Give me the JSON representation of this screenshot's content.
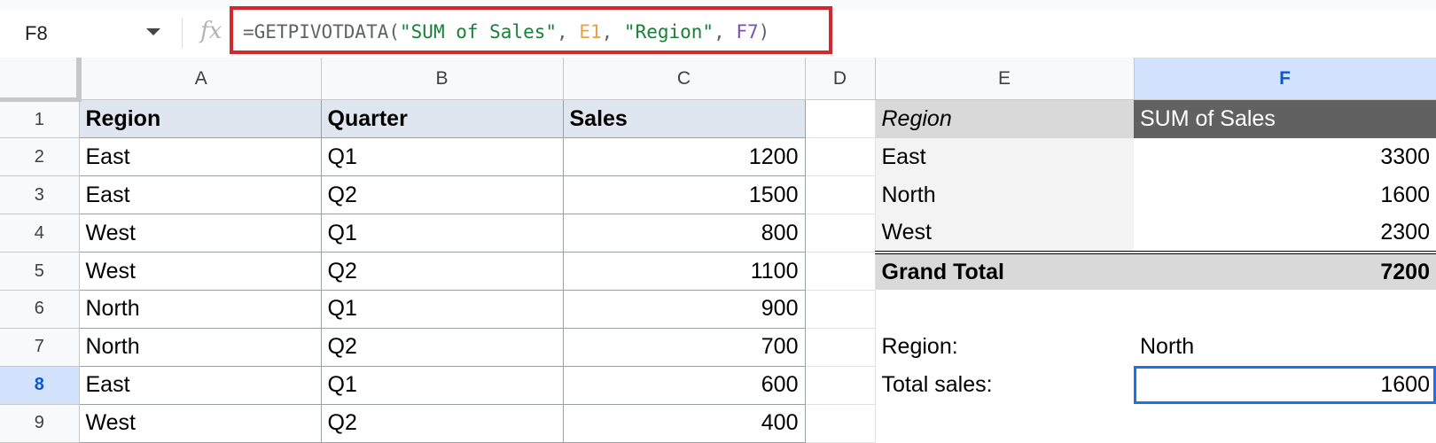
{
  "name_box": {
    "ref": "F8"
  },
  "formula_bar": {
    "fx_symbol": "fx",
    "formula_parts": {
      "start": "=GETPIVOTDATA(",
      "arg1": "\"SUM of Sales\"",
      "sep1": ", ",
      "arg2": "E1",
      "sep2": ", ",
      "arg3": "\"Region\"",
      "sep3": ", ",
      "arg4": "F7",
      "end": ")"
    }
  },
  "columns": [
    "A",
    "B",
    "C",
    "D",
    "E",
    "F"
  ],
  "rows": [
    "1",
    "2",
    "3",
    "4",
    "5",
    "6",
    "7",
    "8",
    "9"
  ],
  "selected": {
    "column": "F",
    "row": "8"
  },
  "sheet": {
    "headers": [
      "Region",
      "Quarter",
      "Sales"
    ],
    "data": [
      [
        "East",
        "Q1",
        "1200"
      ],
      [
        "East",
        "Q2",
        "1500"
      ],
      [
        "West",
        "Q1",
        "800"
      ],
      [
        "West",
        "Q2",
        "1100"
      ],
      [
        "North",
        "Q1",
        "900"
      ],
      [
        "North",
        "Q2",
        "700"
      ],
      [
        "East",
        "Q1",
        "600"
      ],
      [
        "West",
        "Q2",
        "400"
      ]
    ]
  },
  "pivot": {
    "row_header": "Region",
    "value_header": "SUM of Sales",
    "rows": [
      [
        "East",
        "3300"
      ],
      [
        "North",
        "1600"
      ],
      [
        "West",
        "2300"
      ]
    ],
    "grand_total_label": "Grand Total",
    "grand_total_value": "7200"
  },
  "lookup": {
    "region_label": "Region:",
    "region_value": "North",
    "total_label": "Total sales:",
    "total_value": "1600"
  }
}
